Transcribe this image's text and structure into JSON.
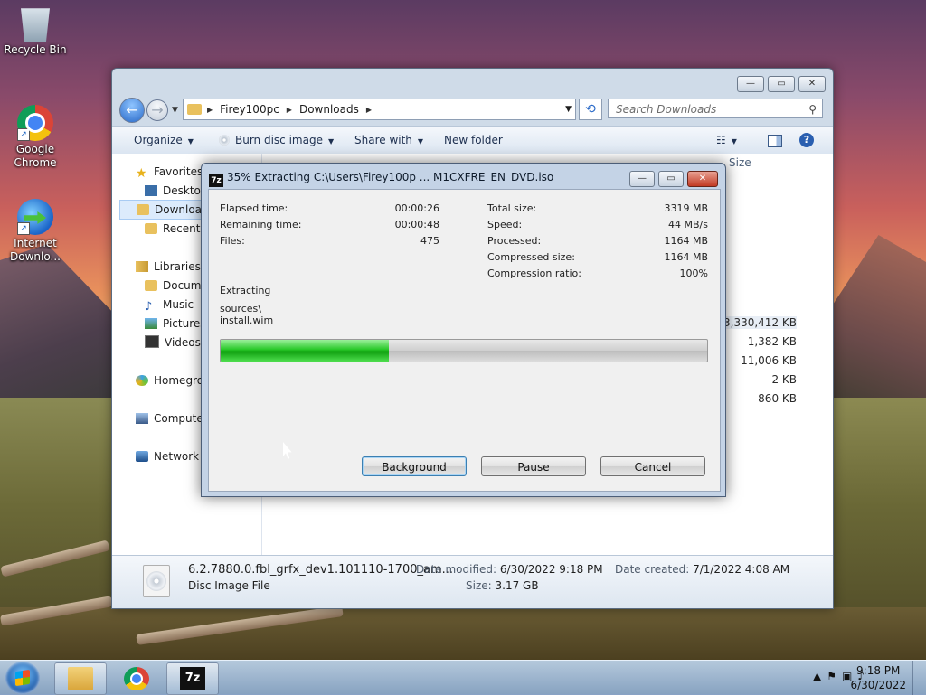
{
  "desktop": {
    "icons": [
      {
        "label": "Recycle Bin"
      },
      {
        "label": "Google Chrome"
      },
      {
        "label": "Internet Downlo..."
      }
    ]
  },
  "explorer": {
    "breadcrumb": [
      "Firey100pc",
      "Downloads"
    ],
    "search_placeholder": "Search Downloads",
    "toolbar": {
      "organize": "Organize",
      "burn": "Burn disc image",
      "share": "Share with",
      "new_folder": "New folder"
    },
    "nav": {
      "favorites": "Favorites",
      "desktop": "Desktop",
      "downloads": "Downloads",
      "recent": "Recent Places",
      "libraries": "Libraries",
      "documents": "Documents",
      "music": "Music",
      "pictures": "Pictures",
      "videos": "Videos",
      "homegroup": "Homegroup",
      "computer": "Computer",
      "network": "Network"
    },
    "size_header": "Size",
    "sizes": [
      "3,330,412 KB",
      "1,382 KB",
      "11,006 KB",
      "2 KB",
      "860 KB"
    ],
    "details": {
      "name": "6.2.7880.0.fbl_grfx_dev1.101110-1700_am...",
      "type": "Disc Image File",
      "modified_label": "Date modified:",
      "modified": "6/30/2022 9:18 PM",
      "created_label": "Date created:",
      "created": "7/1/2022 4:08 AM",
      "size_label": "Size:",
      "size": "3.17 GB"
    }
  },
  "dialog": {
    "title": "35% Extracting C:\\Users\\Firey100p ... M1CXFRE_EN_DVD.iso",
    "icon_label": "7z",
    "elapsed_label": "Elapsed time:",
    "elapsed": "00:00:26",
    "remaining_label": "Remaining time:",
    "remaining": "00:00:48",
    "files_label": "Files:",
    "files": "475",
    "total_label": "Total size:",
    "total": "3319 MB",
    "speed_label": "Speed:",
    "speed": "44 MB/s",
    "processed_label": "Processed:",
    "processed": "1164 MB",
    "compressed_label": "Compressed size:",
    "compressed": "1164 MB",
    "ratio_label": "Compression ratio:",
    "ratio": "100%",
    "status": "Extracting",
    "path_line1": "sources\\",
    "path_line2": "install.wim",
    "progress": 0.345,
    "buttons": {
      "background": "Background",
      "pause": "Pause",
      "cancel": "Cancel"
    }
  },
  "taskbar": {
    "time": "9:18 PM",
    "date": "6/30/2022",
    "app_7z": "7z"
  }
}
